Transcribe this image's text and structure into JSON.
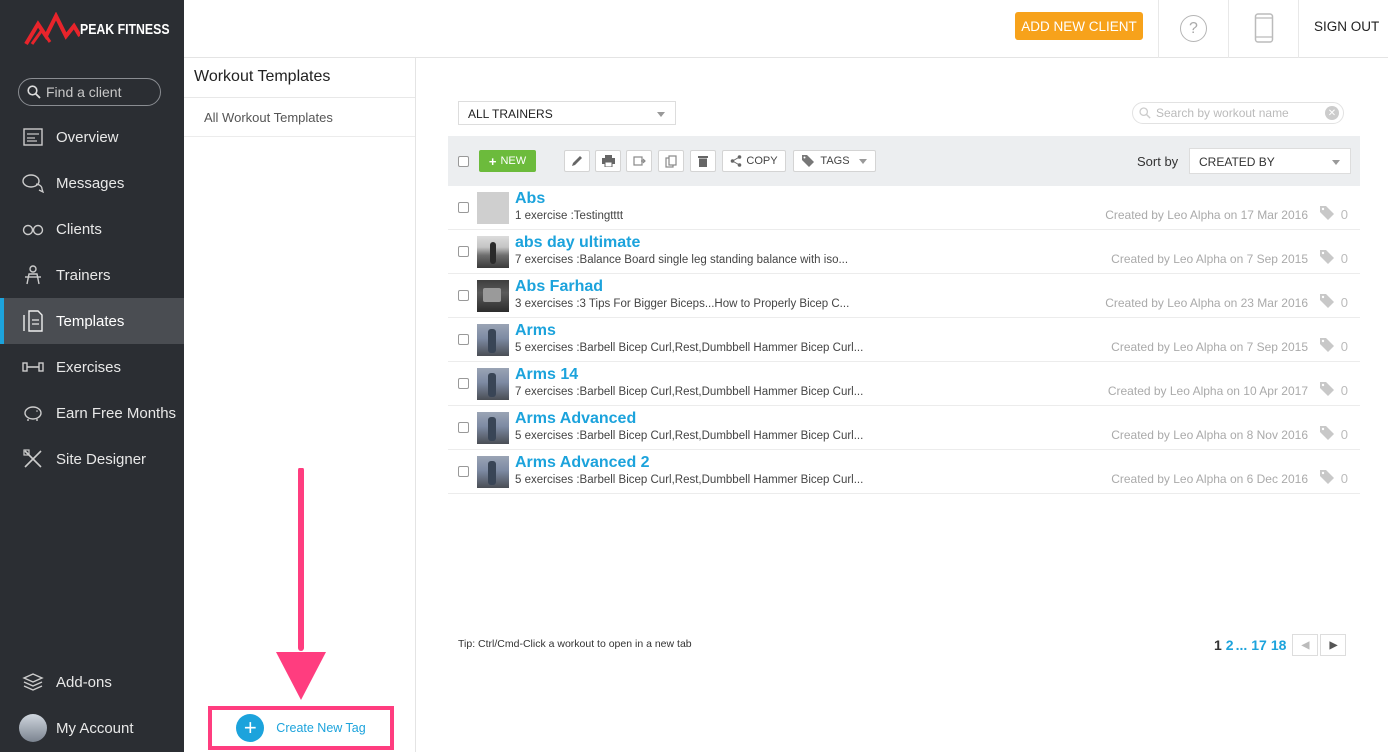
{
  "brand": {
    "name": "PEAK FITNESS",
    "accent": "#1ca3dc",
    "logo_red": "#e8242b"
  },
  "sidebar": {
    "search_placeholder": "Find a client",
    "items": [
      {
        "label": "Overview",
        "icon": "overview-icon"
      },
      {
        "label": "Messages",
        "icon": "messages-icon"
      },
      {
        "label": "Clients",
        "icon": "clients-icon"
      },
      {
        "label": "Trainers",
        "icon": "trainers-icon"
      },
      {
        "label": "Templates",
        "icon": "templates-icon",
        "active": true
      },
      {
        "label": "Exercises",
        "icon": "dumbbell-icon"
      },
      {
        "label": "Earn Free Months",
        "icon": "piggy-bank-icon"
      },
      {
        "label": "Site Designer",
        "icon": "site-designer-icon"
      }
    ],
    "bottom": [
      {
        "label": "Add-ons",
        "icon": "layers-icon"
      },
      {
        "label": "My Account",
        "icon": "avatar"
      }
    ]
  },
  "topbar": {
    "add_client": "ADD NEW CLIENT",
    "help": "?",
    "sign_out": "SIGN OUT",
    "colors": {
      "add_client_bg": "#f7a21b"
    }
  },
  "panel": {
    "title": "Workout Templates",
    "item": "All Workout Templates",
    "create_tag": "Create New Tag",
    "highlight_color": "#ff3d7f"
  },
  "main": {
    "trainer_filter": "ALL TRAINERS",
    "search_placeholder": "Search by workout name",
    "toolbar": {
      "new_label": "NEW",
      "copy_label": "COPY",
      "tags_label": "TAGS",
      "sort_label": "Sort by",
      "sort_value": "CREATED BY"
    },
    "rows": [
      {
        "title": "Abs",
        "sub": "1 exercise :Testingtttt",
        "meta": "Created by Leo Alpha on 17 Mar 2016",
        "tags": "0",
        "thumb": "blank"
      },
      {
        "title": "abs day ultimate",
        "sub": "7 exercises :Balance Board single leg standing balance with iso...",
        "meta": "Created by Leo Alpha on 7 Sep 2015",
        "tags": "0",
        "thumb": "photo"
      },
      {
        "title": "Abs Farhad",
        "sub": "3 exercises :3 Tips For Bigger Biceps...How to Properly Bicep C...",
        "meta": "Created by Leo Alpha on 23 Mar 2016",
        "tags": "0",
        "thumb": "dark"
      },
      {
        "title": "Arms",
        "sub": "5 exercises :Barbell Bicep Curl,Rest,Dumbbell Hammer Bicep Curl...",
        "meta": "Created by Leo Alpha on 7 Sep 2015",
        "tags": "0",
        "thumb": "blue"
      },
      {
        "title": "Arms 14",
        "sub": "7 exercises :Barbell Bicep Curl,Rest,Dumbbell Hammer Bicep Curl...",
        "meta": "Created by Leo Alpha on 10 Apr 2017",
        "tags": "0",
        "thumb": "blue"
      },
      {
        "title": "Arms Advanced",
        "sub": "5 exercises :Barbell Bicep Curl,Rest,Dumbbell Hammer Bicep Curl...",
        "meta": "Created by Leo Alpha on 8 Nov 2016",
        "tags": "0",
        "thumb": "blue"
      },
      {
        "title": "Arms Advanced 2",
        "sub": "5 exercises :Barbell Bicep Curl,Rest,Dumbbell Hammer Bicep Curl...",
        "meta": "Created by Leo Alpha on 6 Dec 2016",
        "tags": "0",
        "thumb": "blue"
      }
    ],
    "tip": "Tip: Ctrl/Cmd-Click a workout to open in a new tab",
    "pagination": {
      "current": "1",
      "next": "2",
      "ellipsis": "...",
      "p17": "17",
      "p18": "18"
    }
  }
}
